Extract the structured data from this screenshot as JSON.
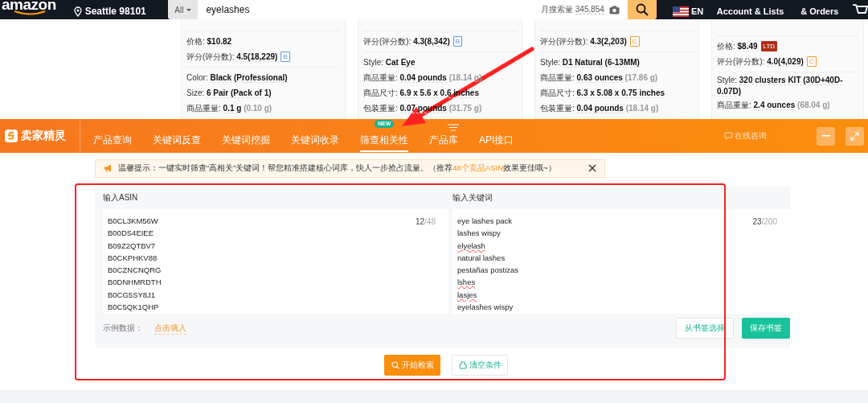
{
  "amazon_header": {
    "logo": "amazon",
    "location": "Seattle 98101",
    "search": {
      "category": "All",
      "value": "eyelashes",
      "volume_label": "月搜索量",
      "volume": "345,854"
    },
    "language": "EN",
    "account": "Account & Lists",
    "orders": "& Orders"
  },
  "product_cards": [
    {
      "groups": [
        [
          {
            "label": "价格:",
            "value": "$10.82"
          },
          {
            "label": "评分(评分数):",
            "value": "4.5(18,229)",
            "badge": {
              "text": "B",
              "kind": "outline",
              "color": "#5b9bf0"
            }
          }
        ],
        [
          {
            "label": "Color:",
            "value": "Black (Professional)"
          },
          {
            "label": "Size:",
            "value": "6 Pair (Pack of 1)"
          },
          {
            "label": "商品重量:",
            "value": "0.1 g",
            "note": "(0.10 g)"
          }
        ]
      ]
    },
    {
      "groups": [
        [
          {
            "label": "评分(评分数):",
            "value": "4.3(8,342)",
            "badge": {
              "text": "B",
              "kind": "outline",
              "color": "#5b9bf0"
            }
          }
        ],
        [
          {
            "label": "Style:",
            "value": "Cat Eye"
          },
          {
            "label": "商品重量:",
            "value": "0.04 pounds",
            "note": "(18.14 g)"
          },
          {
            "label": "商品尺寸:",
            "value": "6.9 x 5.6 x 0.6 inches"
          },
          {
            "label": "包装重量:",
            "value": "0.07 pounds",
            "note": "(31.75 g)"
          }
        ]
      ]
    },
    {
      "groups": [
        [
          {
            "label": "评分(评分数):",
            "value": "4.3(2,203)",
            "badge": {
              "text": "C",
              "kind": "outline",
              "color": "#f0a030"
            }
          }
        ],
        [
          {
            "label": "Style:",
            "value": "D1 Natural (6-13MM)"
          },
          {
            "label": "商品重量:",
            "value": "0.63 ounces",
            "note": "(17.86 g)"
          },
          {
            "label": "商品尺寸:",
            "value": "6.3 x 5.08 x 0.75 inches"
          },
          {
            "label": "包装重量:",
            "value": "0.04 pounds",
            "note": "(18.14 g)"
          }
        ]
      ]
    },
    {
      "groups": [
        [
          {
            "label": "价格:",
            "value": "$8.49",
            "badge": {
              "text": "LTD",
              "kind": "solid",
              "color": "#b0301a"
            }
          },
          {
            "label": "评分(评分数):",
            "value": "4.0(4,029)",
            "badge": {
              "text": "C",
              "kind": "outline",
              "color": "#f0a030"
            }
          }
        ],
        [
          {
            "label": "Style:",
            "value": "320 clusters KIT (30D+40D-0.07D)"
          },
          {
            "label": "商品重量:",
            "value": "2.4 ounces",
            "note": "(68.04 g)"
          }
        ]
      ]
    }
  ],
  "nav": {
    "logo": "卖家精灵",
    "tabs": [
      {
        "label": "产品查询",
        "selected": false
      },
      {
        "label": "关键词反查",
        "selected": false
      },
      {
        "label": "关键词挖掘",
        "selected": false
      },
      {
        "label": "关键词收录",
        "selected": false
      },
      {
        "label": "筛查相关性",
        "selected": true,
        "badge": "NEW"
      },
      {
        "label": "产品库",
        "selected": false
      },
      {
        "label": "API接口",
        "selected": false
      }
    ],
    "consult": "在线咨询"
  },
  "tip": {
    "label": "温馨提示：",
    "text_before": "一键实时筛查“高相关”关键词！帮您精准搭建核心词库，快人一步抢占流量。（推荐",
    "highlight": "48个竞品ASIN",
    "text_after": "效果更佳哦~）"
  },
  "form": {
    "asin": {
      "label": "输入ASIN",
      "count": "12",
      "max": "/48",
      "lines": [
        {
          "text": "B0CL3KM56W",
          "misspelled": false
        },
        {
          "text": "B00DS4EIEE",
          "misspelled": false
        },
        {
          "text": "B09Z2QTBV7",
          "misspelled": false
        },
        {
          "text": "B0CKPHKV88",
          "misspelled": false
        },
        {
          "text": "B0CZNCNQRG",
          "misspelled": false
        },
        {
          "text": "B0DNHMRDTH",
          "misspelled": false
        },
        {
          "text": "B0CG5SY8J1",
          "misspelled": false
        },
        {
          "text": "B0C5QK1QHP",
          "misspelled": false
        }
      ]
    },
    "keywords": {
      "label": "输入关键词",
      "count": "23",
      "max": "/200",
      "lines": [
        {
          "text": "eye lashes pack",
          "misspelled": false
        },
        {
          "text": "lashes wispy",
          "misspelled": false
        },
        {
          "text": "elyelash",
          "misspelled": true
        },
        {
          "text": "natural lashes",
          "misspelled": false
        },
        {
          "text": "pestañas postizas",
          "misspelled": false
        },
        {
          "text": "lshes",
          "misspelled": true
        },
        {
          "text": "lasjes",
          "misspelled": true
        },
        {
          "text": "eyelashes wispy",
          "misspelled": false
        }
      ]
    },
    "example_label": "示例数据：",
    "example_link": "点击填入",
    "bookmark_select": "从书签选择",
    "bookmark_save": "保存书签",
    "search": "开始检索",
    "clear": "清空条件"
  }
}
